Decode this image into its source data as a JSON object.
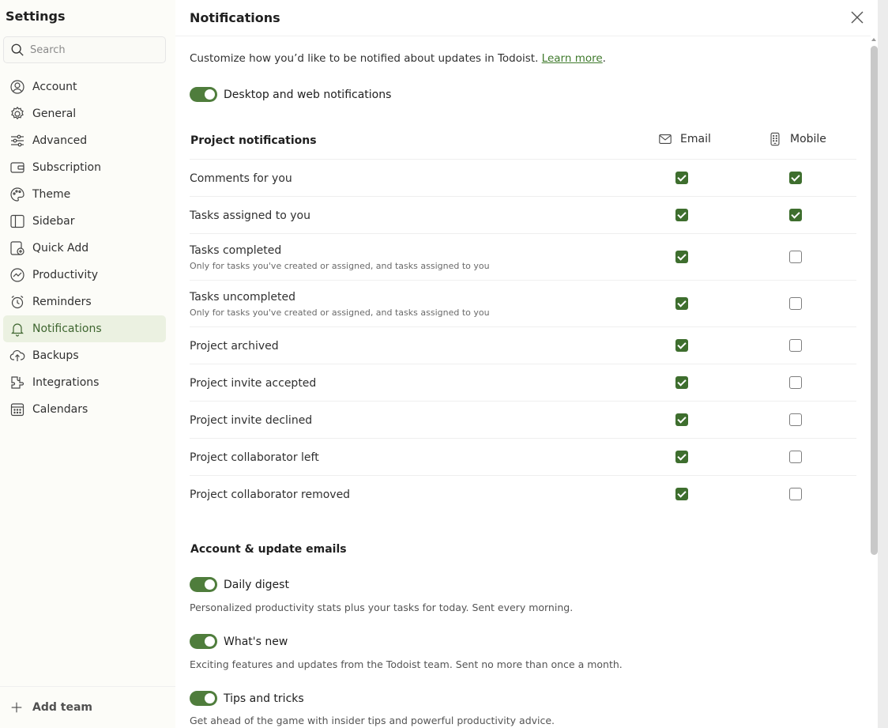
{
  "sidebar": {
    "title": "Settings",
    "search_placeholder": "Search",
    "items": [
      {
        "label": "Account",
        "icon": "account-icon"
      },
      {
        "label": "General",
        "icon": "gear-icon"
      },
      {
        "label": "Advanced",
        "icon": "sliders-icon"
      },
      {
        "label": "Subscription",
        "icon": "wallet-icon"
      },
      {
        "label": "Theme",
        "icon": "palette-icon"
      },
      {
        "label": "Sidebar",
        "icon": "sidebar-icon"
      },
      {
        "label": "Quick Add",
        "icon": "quick-add-icon"
      },
      {
        "label": "Productivity",
        "icon": "productivity-icon"
      },
      {
        "label": "Reminders",
        "icon": "alarm-icon"
      },
      {
        "label": "Notifications",
        "icon": "bell-icon",
        "active": true
      },
      {
        "label": "Backups",
        "icon": "cloud-upload-icon"
      },
      {
        "label": "Integrations",
        "icon": "puzzle-icon"
      },
      {
        "label": "Calendars",
        "icon": "calendar-icon"
      }
    ],
    "add_team": "Add team"
  },
  "main": {
    "title": "Notifications",
    "intro_text": "Customize how you’d like to be notified about updates in Todoist. ",
    "learn_more": "Learn more",
    "intro_suffix": ".",
    "desktop_toggle": {
      "label": "Desktop and web notifications",
      "on": true
    },
    "project_section": {
      "title": "Project notifications",
      "col_email": "Email",
      "col_mobile": "Mobile",
      "rows": [
        {
          "label": "Comments for you",
          "sub": "",
          "email": true,
          "mobile": true
        },
        {
          "label": "Tasks assigned to you",
          "sub": "",
          "email": true,
          "mobile": true
        },
        {
          "label": "Tasks completed",
          "sub": "Only for tasks you've created or assigned, and tasks assigned to you",
          "email": true,
          "mobile": false
        },
        {
          "label": "Tasks uncompleted",
          "sub": "Only for tasks you've created or assigned, and tasks assigned to you",
          "email": true,
          "mobile": false
        },
        {
          "label": "Project archived",
          "sub": "",
          "email": true,
          "mobile": false
        },
        {
          "label": "Project invite accepted",
          "sub": "",
          "email": true,
          "mobile": false
        },
        {
          "label": "Project invite declined",
          "sub": "",
          "email": true,
          "mobile": false
        },
        {
          "label": "Project collaborator left",
          "sub": "",
          "email": true,
          "mobile": false
        },
        {
          "label": "Project collaborator removed",
          "sub": "",
          "email": true,
          "mobile": false
        }
      ]
    },
    "account_section": {
      "title": "Account & update emails",
      "items": [
        {
          "label": "Daily digest",
          "desc": "Personalized productivity stats plus your tasks for today. Sent every morning.",
          "on": true
        },
        {
          "label": "What's new",
          "desc": "Exciting features and updates from the Todoist team. Sent no more than once a month.",
          "on": true
        },
        {
          "label": "Tips and tricks",
          "desc": "Get ahead of the game with insider tips and powerful productivity advice.",
          "on": true
        }
      ]
    }
  },
  "colors": {
    "accent": "#4f7d3c",
    "checkbox_checked": "#3e6e2e",
    "active_nav_bg": "#ebf1e1",
    "link": "#3f7a2c"
  }
}
